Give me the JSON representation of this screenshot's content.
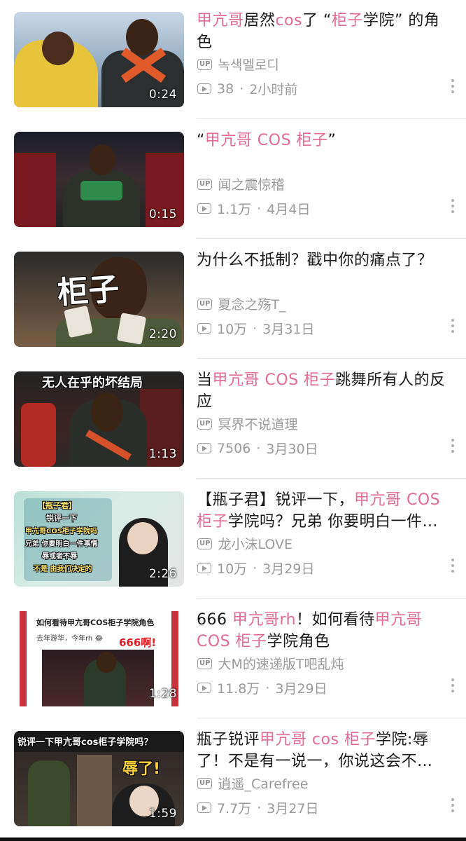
{
  "videos": [
    {
      "duration": "0:24",
      "title_parts": [
        {
          "t": "甲亢哥",
          "hl": true
        },
        {
          "t": "居然",
          "hl": false
        },
        {
          "t": "cos",
          "hl": true
        },
        {
          "t": "了 “",
          "hl": false
        },
        {
          "t": "柜子",
          "hl": true
        },
        {
          "t": "学院” 的角色",
          "hl": false
        }
      ],
      "up_badge": "UP",
      "author": "녹색멜로디",
      "views": "38",
      "sep": "·",
      "time": "2小时前"
    },
    {
      "duration": "0:15",
      "title_parts": [
        {
          "t": "“",
          "hl": false
        },
        {
          "t": "甲亢哥 COS 柜子",
          "hl": true
        },
        {
          "t": "”",
          "hl": false
        }
      ],
      "up_badge": "UP",
      "author": "闻之震惊稽",
      "views": "1.1万",
      "sep": "·",
      "time": "4月4日"
    },
    {
      "duration": "2:20",
      "title_parts": [
        {
          "t": "为什么不抵制？戳中你的痛点了？",
          "hl": false
        }
      ],
      "thumb_text": "柜子",
      "up_badge": "UP",
      "author": "夏念之殇T_",
      "views": "10万",
      "sep": "·",
      "time": "3月31日"
    },
    {
      "duration": "1:13",
      "title_parts": [
        {
          "t": "当",
          "hl": false
        },
        {
          "t": "甲亢哥 COS 柜子",
          "hl": true
        },
        {
          "t": "跳舞所有人的反应",
          "hl": false
        }
      ],
      "thumb_text": "无人在乎的坏结局",
      "up_badge": "UP",
      "author": "冥界不说道理",
      "views": "7506",
      "sep": "·",
      "time": "3月30日"
    },
    {
      "duration": "2:26",
      "title_parts": [
        {
          "t": "【瓶子君】锐评一下，",
          "hl": false
        },
        {
          "t": "甲亢哥 COS 柜子",
          "hl": true
        },
        {
          "t": "学院吗？兄弟 你要明白一件…",
          "hl": false
        }
      ],
      "thumb_lines": [
        "【瓶子君】",
        "锐评一下",
        "甲亢哥COS柜子学院吗",
        "兄弟 你要明白一件事情",
        "辱或者不辱",
        "不是 由我们决定的"
      ],
      "up_badge": "UP",
      "author": "龙小沫LOVE",
      "views": "10万",
      "sep": "·",
      "time": "3月29日"
    },
    {
      "duration": "1:28",
      "title_parts": [
        {
          "t": "666 ",
          "hl": false
        },
        {
          "t": "甲亢哥",
          "hl": true
        },
        {
          "t": "rh",
          "hl": true
        },
        {
          "t": "！如何看待",
          "hl": false
        },
        {
          "t": "甲亢哥 COS 柜子",
          "hl": true
        },
        {
          "t": "学院角色",
          "hl": false
        }
      ],
      "thumb_lines": [
        "如何看待甲亢哥COS柜子学院角色",
        "去年游华，今年rh 😂",
        "666啊!"
      ],
      "up_badge": "UP",
      "author": "大M的速递版T吧乱炖",
      "views": "11.8万",
      "sep": "·",
      "time": "3月29日"
    },
    {
      "duration": "1:59",
      "title_parts": [
        {
          "t": "瓶子锐评",
          "hl": false
        },
        {
          "t": "甲亢哥 cos 柜子",
          "hl": true
        },
        {
          "t": "学院:辱了！不是有一说一，你说这会不…",
          "hl": false
        }
      ],
      "thumb_lines": [
        "锐评一下甲亢哥cos柜子学院吗？",
        "辱了!"
      ],
      "up_badge": "UP",
      "author": "逍遥_Carefree",
      "views": "7.7万",
      "sep": "·",
      "time": "3月27日"
    }
  ],
  "colors": {
    "highlight": "#e36a95",
    "meta": "#9a9a9a"
  }
}
